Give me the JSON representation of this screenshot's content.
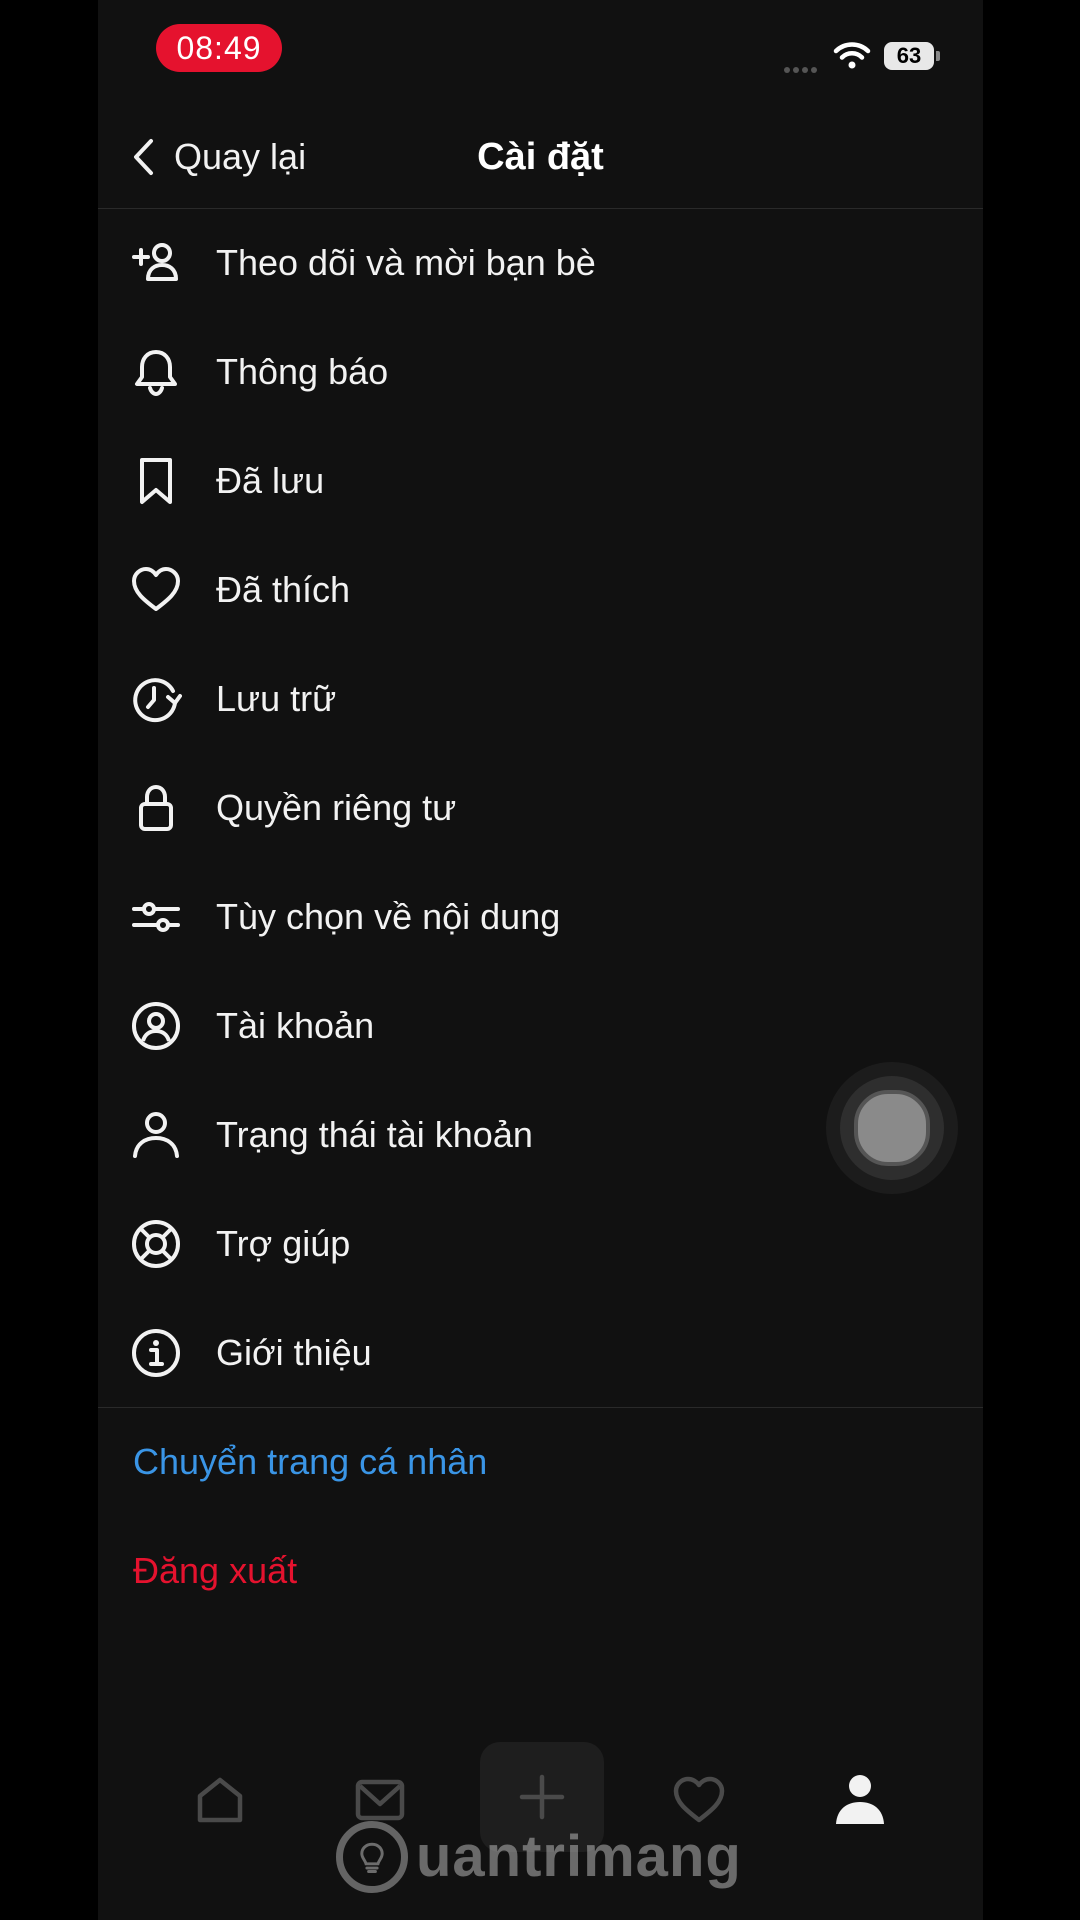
{
  "status_bar": {
    "time": "08:49",
    "battery": "63"
  },
  "header": {
    "back_label": "Quay lại",
    "title": "Cài đặt"
  },
  "menu": {
    "items": [
      {
        "label": "Theo dõi và mời bạn bè",
        "icon": "add-user-icon"
      },
      {
        "label": "Thông báo",
        "icon": "bell-icon"
      },
      {
        "label": "Đã lưu",
        "icon": "bookmark-icon"
      },
      {
        "label": "Đã thích",
        "icon": "heart-icon"
      },
      {
        "label": "Lưu trữ",
        "icon": "archive-clock-icon"
      },
      {
        "label": "Quyền riêng tư",
        "icon": "lock-icon"
      },
      {
        "label": "Tùy chọn về nội dung",
        "icon": "sliders-icon"
      },
      {
        "label": "Tài khoản",
        "icon": "account-circle-icon"
      },
      {
        "label": "Trạng thái tài khoản",
        "icon": "person-icon"
      },
      {
        "label": "Trợ giúp",
        "icon": "lifebuoy-icon"
      },
      {
        "label": "Giới thiệu",
        "icon": "info-icon"
      }
    ]
  },
  "actions": {
    "switch_profile": "Chuyển trang cá nhân",
    "logout": "Đăng xuất"
  },
  "tab_bar": {
    "tabs": [
      {
        "icon": "home-icon"
      },
      {
        "icon": "inbox-icon"
      },
      {
        "icon": "plus-icon"
      },
      {
        "icon": "activity-heart-icon"
      },
      {
        "icon": "profile-icon",
        "active": true
      }
    ]
  },
  "watermark": {
    "text": "uantrimang"
  },
  "colors": {
    "background": "#111111",
    "link": "#3a95e6",
    "danger": "#e5122e",
    "time_pill": "#e5122e"
  }
}
